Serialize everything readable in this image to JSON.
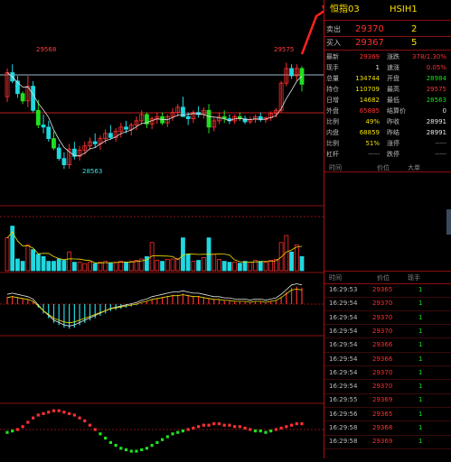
{
  "header": {
    "name": "恒指03",
    "code": "HSIH1"
  },
  "orderbook": [
    {
      "label": "卖出",
      "price": "29370",
      "volume": "2"
    },
    {
      "label": "买入",
      "price": "29367",
      "volume": "5"
    }
  ],
  "quote_rows": [
    {
      "l1": "最新",
      "v1": "29369",
      "c1": "red",
      "l2": "涨跌",
      "v2": "378/1.30%",
      "c2": "red"
    },
    {
      "l1": "现手",
      "v1": "1",
      "c1": "wht",
      "l2": "速涨",
      "v2": "0.05%",
      "c2": "red"
    },
    {
      "l1": "总量",
      "v1": "134744",
      "c1": "yel",
      "l2": "开盘",
      "v2": "28984",
      "c2": "grn"
    },
    {
      "l1": "持仓",
      "v1": "110709",
      "c1": "yel",
      "l2": "最高",
      "v2": "29575",
      "c2": "red"
    },
    {
      "l1": "日增",
      "v1": "14682",
      "c1": "yel",
      "l2": "最低",
      "v2": "28563",
      "c2": "grn"
    },
    {
      "l1": "外盘",
      "v1": "65885",
      "c1": "red",
      "l2": "结算价",
      "v2": "0",
      "c2": "wht"
    },
    {
      "l1": "比例",
      "v1": "49%",
      "c1": "yel",
      "l2": "昨收",
      "v2": "28991",
      "c2": "wht"
    },
    {
      "l1": "内盘",
      "v1": "68859",
      "c1": "yel",
      "l2": "昨结",
      "v2": "28991",
      "c2": "wht"
    },
    {
      "l1": "比例",
      "v1": "51%",
      "c1": "yel",
      "l2": "涨停",
      "v2": "-----",
      "c2": "gry"
    },
    {
      "l1": "杠杆",
      "v1": "-----",
      "c1": "gry",
      "l2": "跌停",
      "v2": "-----",
      "c2": "gry"
    }
  ],
  "upper_headers": {
    "time": "时间",
    "price": "价位",
    "size": "大单"
  },
  "lower_headers": {
    "time": "时间",
    "price": "价位",
    "size": "现手"
  },
  "ticks": [
    {
      "time": "16:29:53",
      "price": "29365",
      "size": "1"
    },
    {
      "time": "16:29:54",
      "price": "29370",
      "size": "1"
    },
    {
      "time": "16:29:54",
      "price": "29370",
      "size": "1"
    },
    {
      "time": "16:29:54",
      "price": "29370",
      "size": "1"
    },
    {
      "time": "16:29:54",
      "price": "29366",
      "size": "1"
    },
    {
      "time": "16:29:54",
      "price": "29366",
      "size": "1"
    },
    {
      "time": "16:29:54",
      "price": "29370",
      "size": "1"
    },
    {
      "time": "16:29:54",
      "price": "29370",
      "size": "1"
    },
    {
      "time": "16:29:55",
      "price": "29369",
      "size": "1"
    },
    {
      "time": "16:29:56",
      "price": "29365",
      "size": "1"
    },
    {
      "time": "16:29:58",
      "price": "29368",
      "size": "1"
    },
    {
      "time": "16:29:58",
      "price": "29369",
      "size": "1"
    }
  ],
  "chart_data": {
    "type": "candlestick",
    "annotations": {
      "high": "29568",
      "low": "28563",
      "high_right": "29575"
    },
    "price_min": 28450,
    "price_max": 29700,
    "candles": [
      [
        29250,
        29520,
        29200,
        29480
      ],
      [
        29480,
        29560,
        29380,
        29400
      ],
      [
        29400,
        29450,
        29240,
        29280
      ],
      [
        29280,
        29300,
        29180,
        29210
      ],
      [
        29210,
        29450,
        29150,
        29350
      ],
      [
        29350,
        29400,
        29100,
        29120
      ],
      [
        29120,
        29220,
        28950,
        28980
      ],
      [
        28980,
        29080,
        28900,
        28960
      ],
      [
        28960,
        29020,
        28820,
        28850
      ],
      [
        28850,
        28920,
        28740,
        28760
      ],
      [
        28760,
        28800,
        28640,
        28660
      ],
      [
        28660,
        28720,
        28560,
        28600
      ],
      [
        28600,
        28800,
        28563,
        28750
      ],
      [
        28750,
        28820,
        28650,
        28680
      ],
      [
        28680,
        28780,
        28640,
        28740
      ],
      [
        28740,
        28820,
        28700,
        28780
      ],
      [
        28780,
        28860,
        28740,
        28820
      ],
      [
        28820,
        28900,
        28760,
        28800
      ],
      [
        28800,
        28880,
        28740,
        28850
      ],
      [
        28850,
        28940,
        28800,
        28900
      ],
      [
        28900,
        28980,
        28840,
        28860
      ],
      [
        28860,
        28950,
        28820,
        28920
      ],
      [
        28920,
        29000,
        28860,
        28960
      ],
      [
        28960,
        29020,
        28900,
        28940
      ],
      [
        28940,
        29000,
        28880,
        28980
      ],
      [
        28980,
        29060,
        28930,
        29020
      ],
      [
        29020,
        29120,
        28980,
        29080
      ],
      [
        29080,
        29100,
        28950,
        28990
      ],
      [
        28990,
        29060,
        28940,
        29040
      ],
      [
        29040,
        29100,
        28990,
        29060
      ],
      [
        29060,
        29100,
        28980,
        29000
      ],
      [
        29000,
        29080,
        28960,
        29060
      ],
      [
        29060,
        29140,
        29020,
        29100
      ],
      [
        29100,
        29180,
        29060,
        29150
      ],
      [
        29150,
        29250,
        29100,
        29060
      ],
      [
        29060,
        29100,
        28980,
        29040
      ],
      [
        29040,
        29120,
        29000,
        29100
      ],
      [
        29100,
        29160,
        29050,
        29080
      ],
      [
        29080,
        29150,
        29040,
        29120
      ],
      [
        29120,
        29180,
        28900,
        28960
      ],
      [
        28960,
        29050,
        28920,
        29020
      ],
      [
        29020,
        29100,
        28990,
        29060
      ],
      [
        29060,
        29120,
        29000,
        29040
      ],
      [
        29040,
        29080,
        28990,
        29020
      ],
      [
        29020,
        29080,
        28990,
        29060
      ],
      [
        29060,
        29100,
        29020,
        29040
      ],
      [
        29040,
        29070,
        28990,
        29010
      ],
      [
        29010,
        29060,
        28990,
        29030
      ],
      [
        29030,
        29080,
        29000,
        29060
      ],
      [
        29060,
        29100,
        29010,
        29030
      ],
      [
        29030,
        29060,
        29000,
        29050
      ],
      [
        29050,
        29110,
        29020,
        29090
      ],
      [
        29090,
        29140,
        29050,
        29120
      ],
      [
        29120,
        29400,
        29100,
        29380
      ],
      [
        29380,
        29575,
        29350,
        29520
      ],
      [
        29520,
        29560,
        29420,
        29450
      ],
      [
        29450,
        29560,
        29400,
        29520
      ],
      [
        29520,
        29540,
        29300,
        29369
      ]
    ],
    "volumes": [
      70,
      95,
      25,
      20,
      55,
      45,
      35,
      30,
      20,
      20,
      25,
      22,
      40,
      18,
      18,
      15,
      18,
      15,
      18,
      20,
      16,
      18,
      20,
      18,
      20,
      22,
      25,
      30,
      60,
      22,
      20,
      24,
      25,
      26,
      70,
      35,
      20,
      22,
      28,
      70,
      35,
      24,
      20,
      18,
      18,
      16,
      20,
      18,
      22,
      20,
      18,
      22,
      24,
      60,
      75,
      40,
      55,
      30
    ],
    "macd": [
      6,
      7,
      6,
      5,
      4,
      2,
      -3,
      -8,
      -12,
      -16,
      -18,
      -20,
      -21,
      -20,
      -18,
      -16,
      -14,
      -12,
      -10,
      -8,
      -6,
      -5,
      -4,
      -3,
      -2,
      -1,
      1,
      2,
      4,
      5,
      6,
      7,
      8,
      8,
      9,
      8,
      7,
      7,
      6,
      5,
      4,
      4,
      3,
      3,
      2,
      2,
      2,
      1,
      2,
      2,
      1,
      2,
      3,
      6,
      10,
      14,
      15,
      14
    ],
    "oscillator": [
      -2,
      -1,
      0,
      2,
      5,
      8,
      10,
      11,
      12,
      13,
      13,
      12,
      11,
      10,
      8,
      6,
      3,
      0,
      -3,
      -6,
      -9,
      -11,
      -13,
      -14,
      -15,
      -15,
      -14,
      -13,
      -11,
      -9,
      -7,
      -5,
      -3,
      -2,
      -1,
      0,
      1,
      2,
      3,
      3,
      4,
      4,
      3,
      3,
      2,
      2,
      1,
      0,
      -1,
      -1,
      -2,
      -1,
      0,
      1,
      2,
      3,
      4,
      4
    ]
  }
}
